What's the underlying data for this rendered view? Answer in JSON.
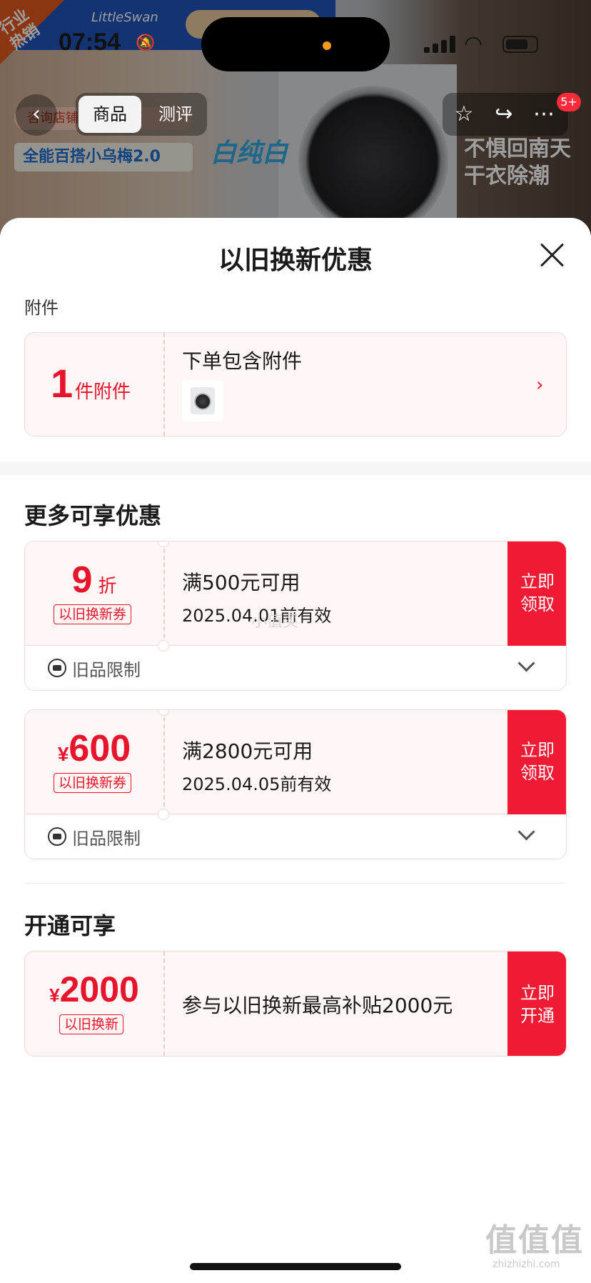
{
  "status_bar": {
    "time": "07:54"
  },
  "background": {
    "hot_label": "行业\n热销",
    "brand": "LittleSwan",
    "promo_line": "咨询店铺客服享优惠",
    "product_line": "全能百搭小乌梅2.0",
    "white_text": "白纯白",
    "right_slogan": "不惧回南天\n干衣除潮"
  },
  "nav": {
    "back": "‹",
    "tabs": [
      "商品",
      "测评"
    ],
    "badge": "5+",
    "icons": [
      "star-icon",
      "share-icon",
      "more-icon"
    ]
  },
  "sheet": {
    "title": "以旧换新优惠",
    "accessory_section_label": "附件",
    "accessory": {
      "count": "1",
      "unit": "件附件",
      "title": "下单包含附件",
      "chevron": "›"
    },
    "more_section_title": "更多可享优惠",
    "coupons": [
      {
        "big_value": "9",
        "big_unit": "折",
        "tag": "以旧换新券",
        "condition": "满500元可用",
        "validity": "2025.04.01前有效",
        "button": "立即\n领取",
        "limit": "旧品限制"
      },
      {
        "currency": "¥",
        "big_value": "600",
        "tag": "以旧换新券",
        "condition": "满2800元可用",
        "validity": "2025.04.05前有效",
        "button": "立即\n领取",
        "limit": "旧品限制"
      }
    ],
    "open_section_title": "开通可享",
    "open_offer": {
      "currency": "¥",
      "big_value": "2000",
      "tag": "以旧换新",
      "text": "参与以旧换新最高补贴2000元",
      "button": "立即\n开通"
    }
  },
  "watermark": {
    "main": "值值值",
    "sub": "zhizhizhi.com",
    "mid": "小值买"
  },
  "colors": {
    "accent_red": "#e8142c",
    "button_red": "#ef1a33",
    "card_bg": "#fff6f6"
  }
}
